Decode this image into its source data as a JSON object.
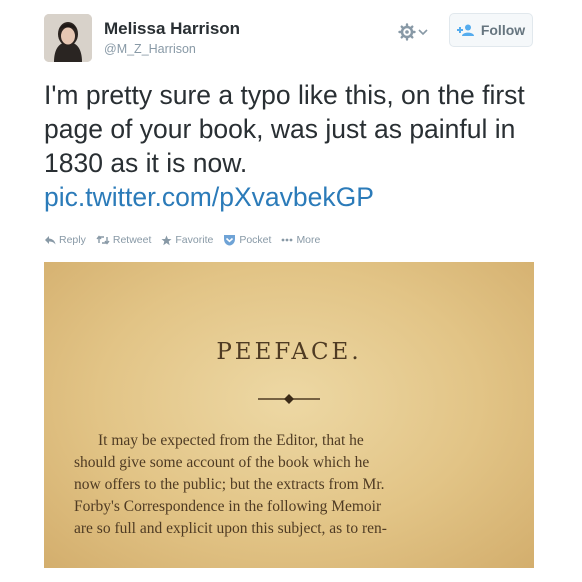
{
  "user": {
    "name": "Melissa Harrison",
    "handle": "@M_Z_Harrison"
  },
  "header": {
    "follow_label": "Follow",
    "gear_icon": "gear-icon",
    "chevron_icon": "chevron-down-icon"
  },
  "tweet": {
    "text": "I'm pretty sure a typo like this, on the first page of your book, was just as painful in 1830 as it is now.",
    "link": "pic.twitter.com/pXvavbekGP"
  },
  "actions": [
    {
      "label": "Reply",
      "icon": "reply-icon"
    },
    {
      "label": "Retweet",
      "icon": "retweet-icon"
    },
    {
      "label": "Favorite",
      "icon": "star-icon"
    },
    {
      "label": "Pocket",
      "icon": "pocket-icon"
    },
    {
      "label": "More",
      "icon": "more-icon"
    }
  ],
  "photo": {
    "heading": "PEEFACE.",
    "lines": [
      "It may be expected from the Editor, that he",
      "should give some account of the book which he",
      "now offers to the public; but the extracts from Mr.",
      "Forby's Correspondence in the following Memoir",
      "are so full and explicit upon this subject, as to ren-"
    ]
  },
  "colors": {
    "link": "#2b7bb9",
    "muted": "#8899a6",
    "paper": "#e2c486",
    "ink": "#4f3b23"
  }
}
